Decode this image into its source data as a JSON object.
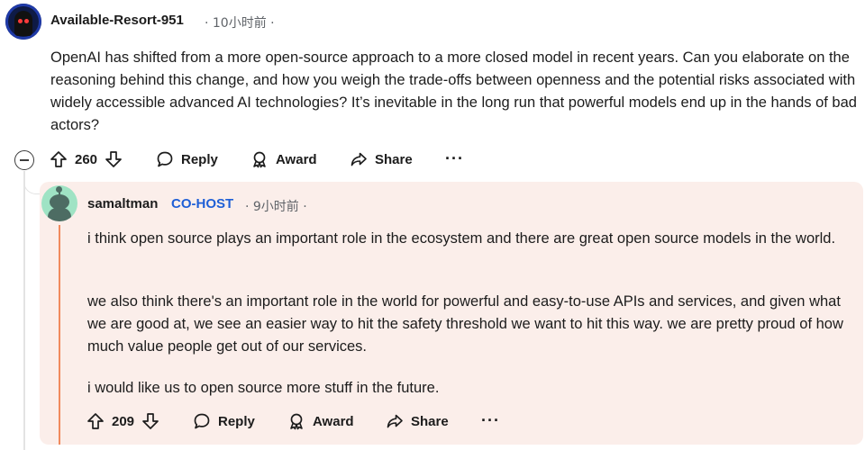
{
  "parent_comment": {
    "username": "Available-Resort-951",
    "meta": "· 10小时前 ·",
    "body": "OpenAI has shifted from a more open-source approach to a more closed model in recent years. Can you elaborate on the reasoning behind this change, and how you weigh the trade-offs between openness and the potential risks associated with widely accessible advanced AI technologies? It’s inevitable in the long run that powerful models end up in the hands of bad actors?",
    "actions": {
      "vote_count": "260",
      "reply_label": "Reply",
      "award_label": "Award",
      "share_label": "Share",
      "more_label": "···"
    }
  },
  "reply_comment": {
    "username": "samaltman",
    "badge": "CO-HOST",
    "meta": "· 9小时前 ·",
    "paragraphs": [
      "i think open source plays an important role in the ecosystem and there are great open source models in the world.",
      "we also think there's an important role in the world for powerful and easy-to-use APIs and services, and given what we are good at, we see an easier way to hit the safety threshold we want to hit this way. we are pretty proud of how much value people get out of our services.",
      "i would like us to open source more stuff in the future."
    ],
    "actions": {
      "vote_count": "209",
      "reply_label": "Reply",
      "award_label": "Award",
      "share_label": "Share",
      "more_label": "···"
    }
  },
  "colors": {
    "cohost_badge": "#1f5fd6",
    "highlight_background": "#fbeeea",
    "highlight_bar": "#f08a5d",
    "reply_avatar": "#9fe3c4"
  },
  "icons": [
    "upvote-icon",
    "downvote-icon",
    "comment-icon",
    "award-icon",
    "share-icon",
    "more-icon",
    "collapse-icon"
  ]
}
